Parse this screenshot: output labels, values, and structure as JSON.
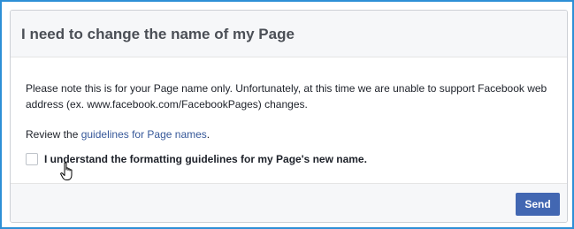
{
  "dialog": {
    "title": "I need to change the name of my Page",
    "note": "Please note this is for your Page name only. Unfortunately, at this time we are unable to support Facebook web address (ex. www.facebook.com/FacebookPages) changes.",
    "review_prefix": "Review the ",
    "review_link": "guidelines for Page names",
    "review_suffix": ".",
    "ack_label": "I understand the formatting guidelines for my Page's new name.",
    "ack_checked": false,
    "send_label": "Send"
  },
  "colors": {
    "frame_border": "#2d8fd6",
    "header_bg": "#f6f7f9",
    "link": "#365899",
    "button": "#4267b2"
  },
  "icons": {
    "cursor": "hand-pointer-icon"
  }
}
